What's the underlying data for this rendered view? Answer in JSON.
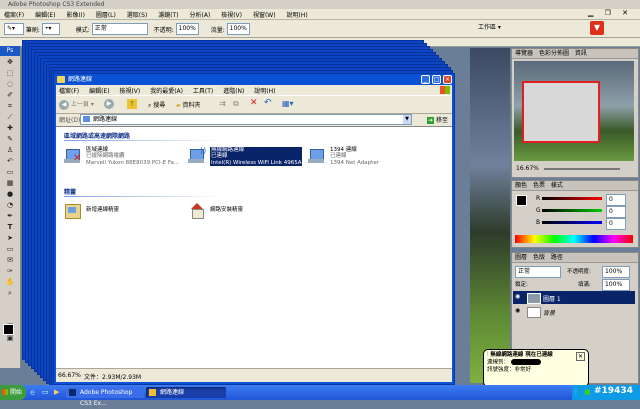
{
  "photoshop": {
    "title": "Adobe Photoshop CS3 Extended",
    "menu": [
      "檔案(F)",
      "編輯(E)",
      "影像(I)",
      "圖層(L)",
      "選取(S)",
      "濾鏡(T)",
      "分析(A)",
      "檢視(V)",
      "視窗(W)",
      "說明(H)"
    ],
    "options": {
      "brush_label": "筆刷:",
      "mode_label": "模式:",
      "mode_value": "正常",
      "opacity_label": "不透明:",
      "opacity_value": "100%",
      "flow_label": "流量:",
      "flow_value": "100%",
      "workspace": "工作區"
    },
    "navigator": {
      "tabs": [
        "導覽器",
        "色彩分佈圖",
        "資訊"
      ],
      "zoom": "16.67%"
    },
    "color": {
      "tabs": [
        "顏色",
        "色票",
        "樣式"
      ],
      "r_label": "R",
      "g_label": "G",
      "b_label": "B",
      "r": "0",
      "g": "0",
      "b": "0"
    },
    "layers": {
      "tabs": [
        "圖層",
        "色版",
        "路徑"
      ],
      "blend": "正常",
      "opacity_label": "不透明度:",
      "opacity": "100%",
      "lock_label": "鎖定:",
      "fill_label": "填滿:",
      "fill": "100%",
      "items": [
        "圖層 1",
        "背景"
      ]
    }
  },
  "explorer": {
    "title": "網路連線",
    "menu": [
      "檔案(F)",
      "編輯(E)",
      "檢視(V)",
      "我的最愛(A)",
      "工具(T)",
      "進階(N)",
      "說明(H)"
    ],
    "toolbar": {
      "back": "上一頁",
      "search": "搜尋",
      "folders": "資料夾"
    },
    "address_label": "網址(D)",
    "address_value": "網路連線",
    "go": "移至",
    "group1": "區域網路或高速網際網路",
    "connections": [
      {
        "name": "區域連線",
        "status": "已拔除網路電纜",
        "device": "Marvell Yukon 88E8039 PCI-E Fa..."
      },
      {
        "name": "無線網路連線",
        "status": "已連線",
        "device": "Intel(R) Wireless WiFi Link 4965A"
      },
      {
        "name": "1394 連線",
        "status": "已連線",
        "device": "1394 Net Adapter"
      }
    ],
    "group2": "精靈",
    "wizards": [
      "新增連線精靈",
      "網路安裝精靈"
    ],
    "status_zoom": "66.67%",
    "status_doc": "文件：2.93M/2.93M"
  },
  "balloon": {
    "title": "無線網路連線 現在已連線",
    "line1": "連線到：",
    "line2": "訊號強度：非常好"
  },
  "taskbar": {
    "start": "開始",
    "tasks": [
      "Adobe Photoshop CS3 Ex...",
      "網路連線"
    ],
    "watermark": "#19434"
  },
  "colors": {
    "xp_blue": "#0a52d3",
    "taskbar": "#2458d8",
    "selection": "#0a246a",
    "red_icon": "#d42020"
  }
}
